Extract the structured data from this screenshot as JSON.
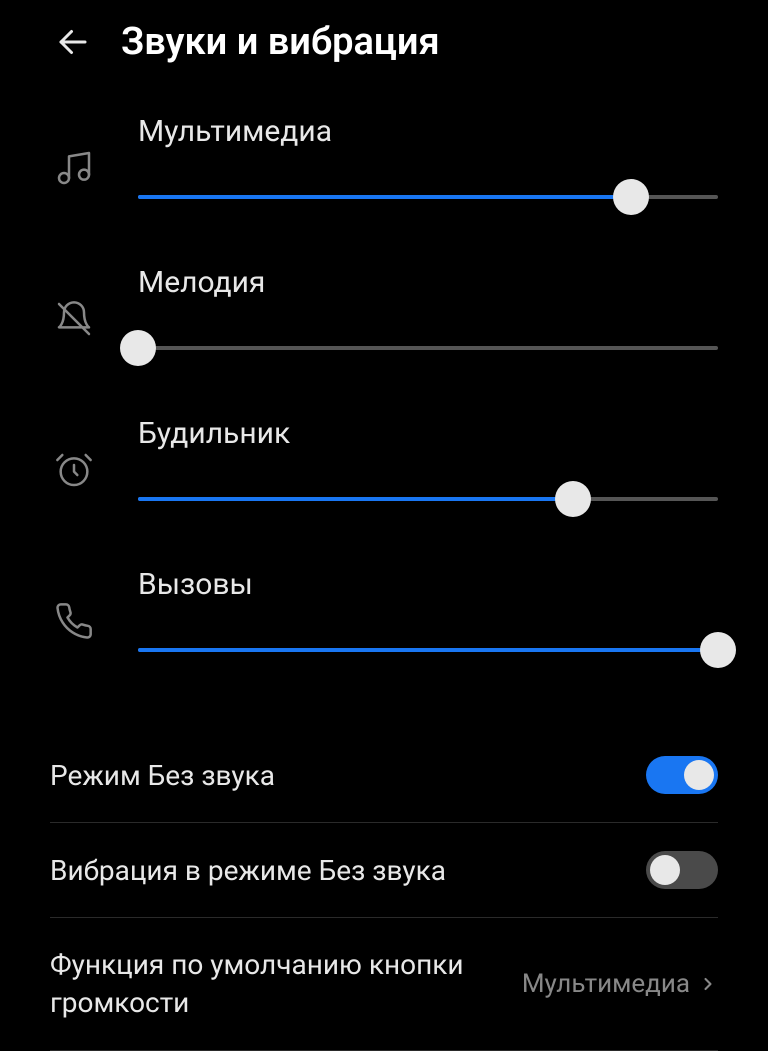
{
  "header": {
    "title": "Звуки и вибрация"
  },
  "sliders": {
    "multimedia": {
      "label": "Мультимедиа",
      "value": 85
    },
    "ringtone": {
      "label": "Мелодия",
      "value": 0
    },
    "alarm": {
      "label": "Будильник",
      "value": 75
    },
    "calls": {
      "label": "Вызовы",
      "value": 100
    }
  },
  "settings": {
    "silent_mode": {
      "label": "Режим Без звука",
      "enabled": true
    },
    "vibrate_silent": {
      "label": "Вибрация в режиме Без звука",
      "enabled": false
    },
    "volume_default": {
      "label": "Функция по умолчанию кнопки громкости",
      "value": "Мультимедиа"
    }
  },
  "colors": {
    "accent": "#1976f2",
    "background": "#000000",
    "text": "#e8e8e8",
    "secondary": "#888888"
  }
}
